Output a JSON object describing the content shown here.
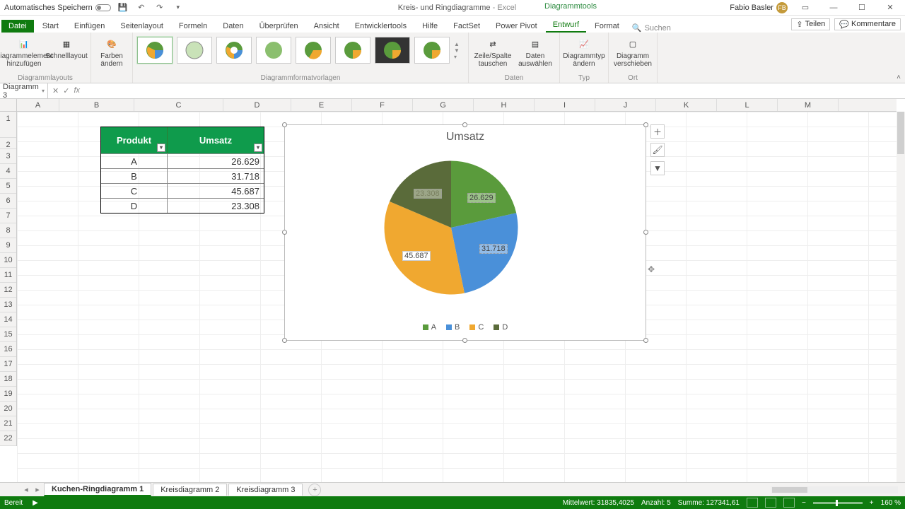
{
  "titlebar": {
    "autosave": "Automatisches Speichern",
    "doc": "Kreis- und Ringdiagramme",
    "app": "Excel",
    "context": "Diagrammtools",
    "user": "Fabio Basler",
    "userInitials": "FB"
  },
  "tabs": {
    "file": "Datei",
    "items": [
      "Start",
      "Einfügen",
      "Seitenlayout",
      "Formeln",
      "Daten",
      "Überprüfen",
      "Ansicht",
      "Entwicklertools",
      "Hilfe",
      "FactSet",
      "Power Pivot",
      "Entwurf",
      "Format"
    ],
    "active": "Entwurf",
    "search": "Suchen",
    "share": "Teilen",
    "comments": "Kommentare"
  },
  "ribbon": {
    "grp_layouts": "Diagrammlayouts",
    "addElement": "Diagrammelement hinzufügen",
    "quickLayout": "Schnelllayout",
    "changeColors": "Farben ändern",
    "grp_styles": "Diagrammformatvorlagen",
    "switchRowCol": "Zeile/Spalte tauschen",
    "selectData": "Daten auswählen",
    "grp_data": "Daten",
    "changeType": "Diagrammtyp ändern",
    "grp_type": "Typ",
    "moveChart": "Diagramm verschieben",
    "grp_loc": "Ort"
  },
  "namebox": "Diagramm 3",
  "columns": [
    "A",
    "B",
    "C",
    "D",
    "E",
    "F",
    "G",
    "H",
    "I",
    "J",
    "K",
    "L",
    "M"
  ],
  "rows": [
    "1",
    "2",
    "3",
    "4",
    "5",
    "6",
    "7",
    "8",
    "9",
    "10",
    "11",
    "12",
    "13",
    "14",
    "15",
    "16",
    "17",
    "18",
    "19",
    "20",
    "21",
    "22"
  ],
  "table": {
    "h1": "Produkt",
    "h2": "Umsatz",
    "rows": [
      {
        "p": "A",
        "v": "26.629"
      },
      {
        "p": "B",
        "v": "31.718"
      },
      {
        "p": "C",
        "v": "45.687"
      },
      {
        "p": "D",
        "v": "23.308"
      }
    ]
  },
  "chart": {
    "title": "Umsatz",
    "labels": {
      "A": "26.629",
      "B": "31.718",
      "C": "45.687",
      "D": "23.308"
    },
    "legend": [
      "A",
      "B",
      "C",
      "D"
    ],
    "colors": {
      "A": "#5a9b3c",
      "B": "#4a90d9",
      "C": "#f0a830",
      "D": "#5a6b3a"
    }
  },
  "sheets": {
    "items": [
      "Kuchen-Ringdiagramm 1",
      "Kreisdiagramm 2",
      "Kreisdiagramm 3"
    ],
    "active": 0
  },
  "status": {
    "ready": "Bereit",
    "avg": "Mittelwert: 31835,4025",
    "count": "Anzahl: 5",
    "sum": "Summe: 127341,61",
    "zoom": "160 %"
  },
  "chart_data": {
    "type": "pie",
    "title": "Umsatz",
    "categories": [
      "A",
      "B",
      "C",
      "D"
    ],
    "values": [
      26629,
      31718,
      45687,
      23308
    ],
    "colors": [
      "#5a9b3c",
      "#4a90d9",
      "#f0a830",
      "#5a6b3a"
    ],
    "data_labels": true,
    "legend_position": "bottom"
  }
}
